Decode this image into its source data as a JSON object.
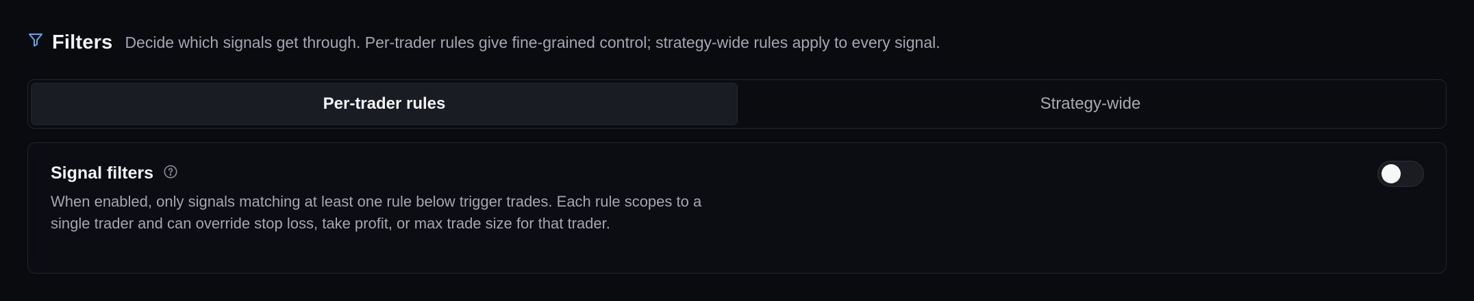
{
  "header": {
    "icon": "filter-icon",
    "accent_color": "#5aa7f2",
    "title": "Filters",
    "subtitle": "Decide which signals get through. Per-trader rules give fine-grained control; strategy-wide rules apply to every signal."
  },
  "tabs": [
    {
      "label": "Per-trader rules",
      "active": true
    },
    {
      "label": "Strategy-wide",
      "active": false
    }
  ],
  "signal_filters": {
    "title": "Signal filters",
    "help_icon": "help-circle-icon",
    "description": "When enabled, only signals matching at least one rule below trigger trades. Each rule scopes to a single trader and can override stop loss, take profit, or max trade size for that trader.",
    "enabled": false
  }
}
